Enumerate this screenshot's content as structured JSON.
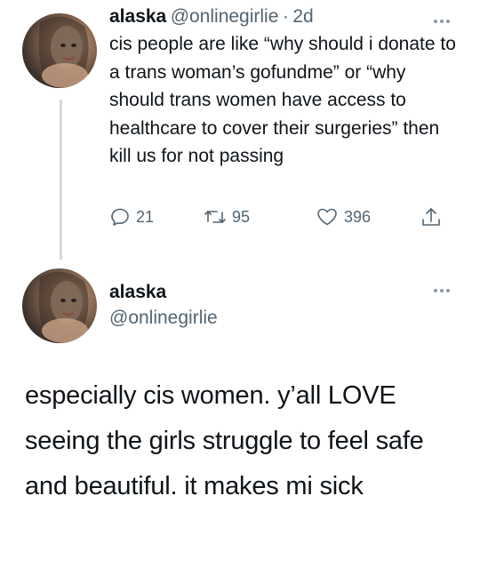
{
  "tweet1": {
    "display_name": "alaska",
    "handle": "@onlinegirlie",
    "separator": "·",
    "timestamp": "2d",
    "text": "cis people are like “why should i donate to a trans woman’s gofundme” or “why should trans women have access to healthcare to cover their surgeries” then kill us for not passing",
    "reply_count": "21",
    "retweet_count": "95",
    "like_count": "396",
    "avatar_icon": "profile-photo"
  },
  "tweet2": {
    "display_name": "alaska",
    "handle": "@onlinegirlie",
    "text": "especially cis women. y’all LOVE seeing the girls struggle to feel safe and beautiful. it makes mi sick",
    "avatar_icon": "profile-photo"
  },
  "icons": {
    "reply": "reply-icon",
    "retweet": "retweet-icon",
    "like": "heart-icon",
    "share": "share-icon",
    "more": "more-icon"
  },
  "colors": {
    "text_primary": "#0f1419",
    "text_secondary": "#536471",
    "thread_line": "#cfd9de"
  }
}
